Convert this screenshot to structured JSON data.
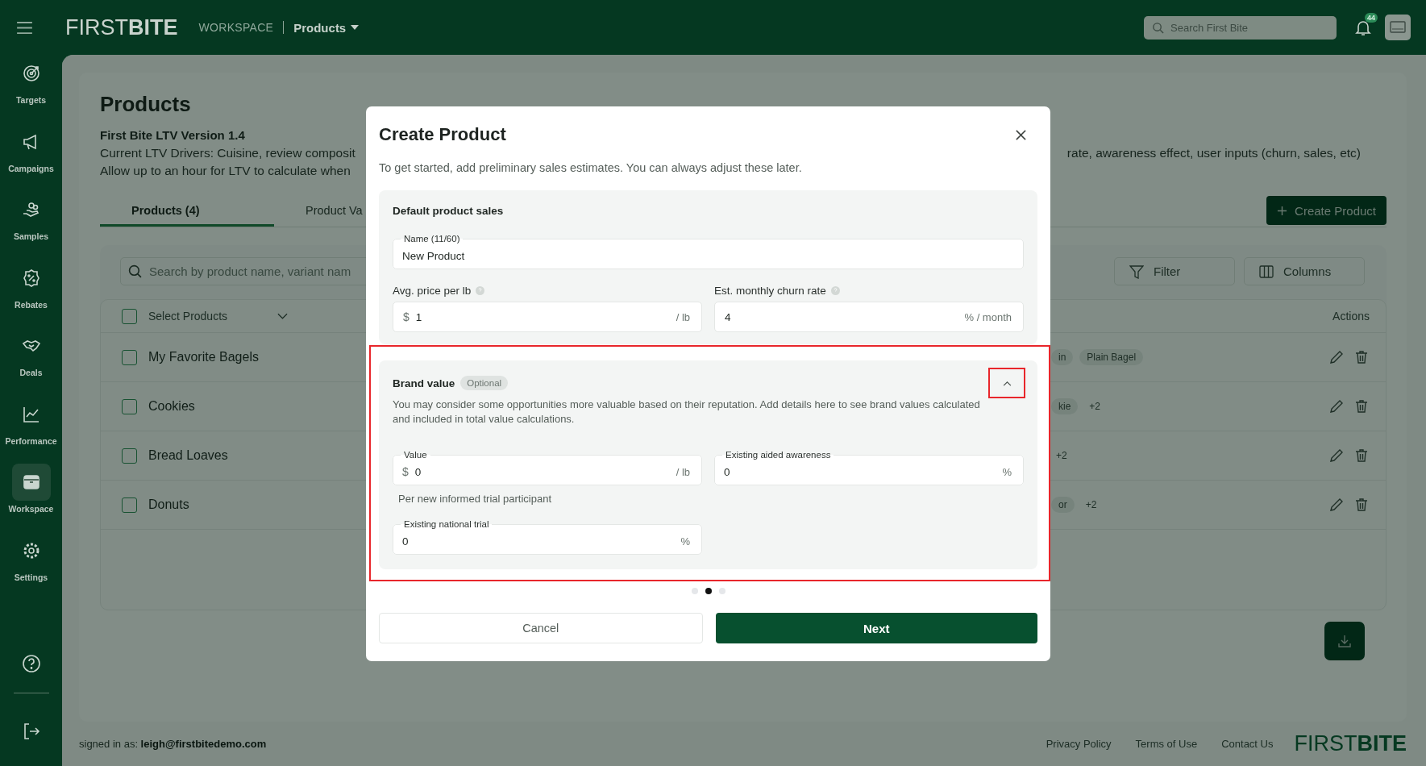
{
  "top_bar": {
    "logo": "FIRST**BITE**",
    "section": "WORKSPACE",
    "page_menu": "Products",
    "search": {
      "placeholder": "Search First Bite"
    },
    "notification_count": "44"
  },
  "sidebar": {
    "items": [
      {
        "label": "Targets",
        "selected": false
      },
      {
        "label": "Campaigns",
        "selected": false
      },
      {
        "label": "Samples",
        "selected": false
      },
      {
        "label": "Rebates",
        "selected": false
      },
      {
        "label": "Deals",
        "selected": false
      },
      {
        "label": "Performance",
        "selected": false
      },
      {
        "label": "Workspace",
        "selected": true
      },
      {
        "label": "Settings",
        "selected": false
      }
    ]
  },
  "page": {
    "title": "Products",
    "version": "First Bite LTV Version 1.4",
    "drivers_start": "Current LTV Drivers: Cuisine, review composit",
    "drivers_end": "rate, awareness effect, user inputs (churn, sales, etc)",
    "note": "Allow up to an hour for LTV to calculate when",
    "tabs": [
      {
        "label": "Products (4)",
        "selected": true
      },
      {
        "label": "Product Va",
        "selected": false
      }
    ],
    "create_button": "Create Product",
    "search": {
      "placeholder": "Search by product name, variant nam"
    },
    "filter_button": "Filter",
    "columns_button": "Columns",
    "table": {
      "select_all_checked": false,
      "select_label": "Select Products",
      "actions_heading": "Actions",
      "rows": [
        {
          "name": "My Favorite Bagels",
          "checked": false,
          "tags": [
            {
              "kind": "chip",
              "text": "in"
            },
            {
              "kind": "chip",
              "text": "Plain Bagel"
            }
          ]
        },
        {
          "name": "Cookies",
          "checked": false,
          "tags": [
            {
              "kind": "chip",
              "text": "kie"
            },
            {
              "kind": "more",
              "text": "+2"
            }
          ]
        },
        {
          "name": "Bread Loaves",
          "checked": false,
          "tags": [
            {
              "kind": "more",
              "text": "+2"
            }
          ]
        },
        {
          "name": "Donuts",
          "checked": false,
          "tags": [
            {
              "kind": "chip",
              "text": "or"
            },
            {
              "kind": "more",
              "text": "+2"
            }
          ]
        }
      ]
    }
  },
  "footer": {
    "signed_in_label": "signed in as:",
    "user_email": "leigh@firstbitedemo.com",
    "links": [
      "Privacy Policy",
      "Terms of Use",
      "Contact Us"
    ],
    "logo": "FIRST**BITE**"
  },
  "modal": {
    "title": "Create Product",
    "subtitle": "To get started, add preliminary sales estimates. You can always adjust these later.",
    "sales": {
      "heading": "Default product sales",
      "name": {
        "label": "Name (11/60)",
        "value": "New Product"
      },
      "price": {
        "label": "Avg. price per lb",
        "prefix": "$",
        "value": "1",
        "suffix": "/ lb"
      },
      "churn": {
        "label": "Est. monthly churn rate",
        "value": "4",
        "suffix": "% / month"
      }
    },
    "brand": {
      "heading": "Brand value",
      "badge": "Optional",
      "expanded": true,
      "description": "You may consider some opportunities more valuable based on their reputation. Add details here to see brand values calculated and included in total value calculations.",
      "value": {
        "label": "Value",
        "prefix": "$",
        "value": "0",
        "suffix": "/ lb"
      },
      "value_hint": "Per new informed trial participant",
      "awareness": {
        "label": "Existing aided awareness",
        "value": "0",
        "suffix": "%"
      },
      "trial": {
        "label": "Existing national trial",
        "value": "0",
        "suffix": "%"
      }
    },
    "steps": [
      {
        "selected": false
      },
      {
        "selected": true
      },
      {
        "selected": false
      }
    ],
    "cancel_button": "Cancel",
    "next_button": "Next"
  }
}
